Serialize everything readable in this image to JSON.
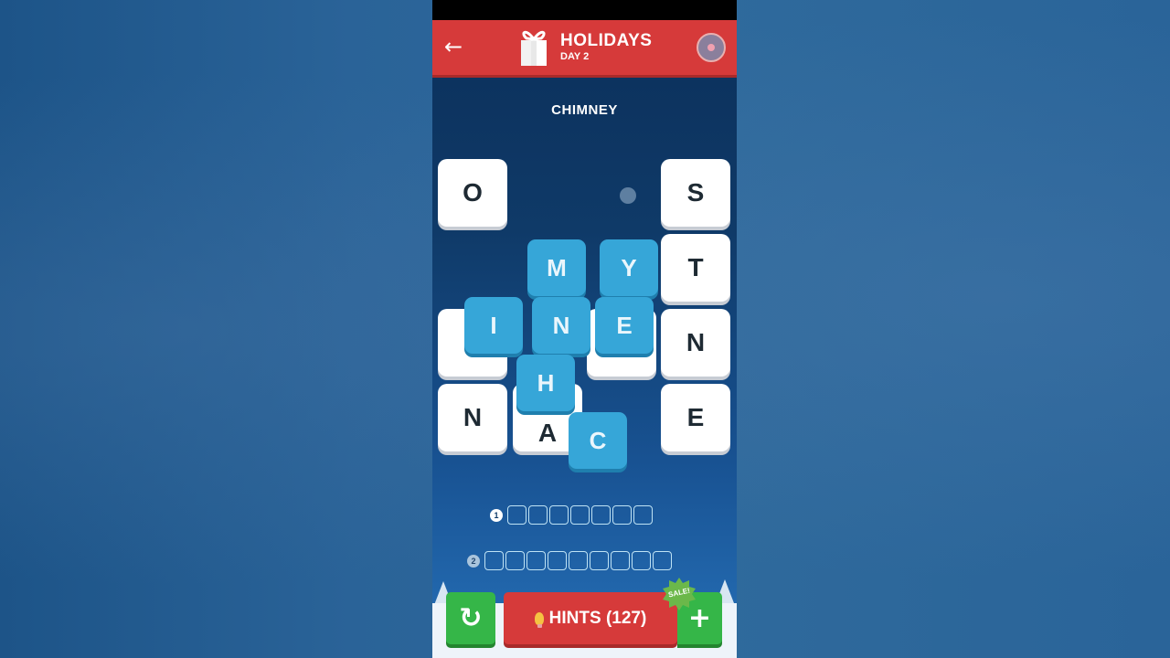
{
  "header": {
    "title": "HOLIDAYS",
    "subtitle": "DAY 2",
    "back_icon": "←"
  },
  "clue": "CHIMNEY",
  "white_tiles": [
    {
      "letter": "O"
    },
    {
      "letter": "S"
    },
    {
      "letter": "T"
    },
    {
      "letter": ""
    },
    {
      "letter": ""
    },
    {
      "letter": "N"
    },
    {
      "letter": "N"
    },
    {
      "letter": "A"
    },
    {
      "letter": "E"
    }
  ],
  "selected_tiles": [
    {
      "letter": "M"
    },
    {
      "letter": "Y"
    },
    {
      "letter": "I"
    },
    {
      "letter": "N"
    },
    {
      "letter": "E"
    },
    {
      "letter": "H"
    },
    {
      "letter": "C"
    }
  ],
  "answers": [
    {
      "number": "1",
      "length": 7
    },
    {
      "number": "2",
      "length": 9
    }
  ],
  "footer": {
    "hints_label": "HINTS (127)",
    "sale_label": "SALE!",
    "plus_label": "+",
    "restart_icon": "↻"
  }
}
